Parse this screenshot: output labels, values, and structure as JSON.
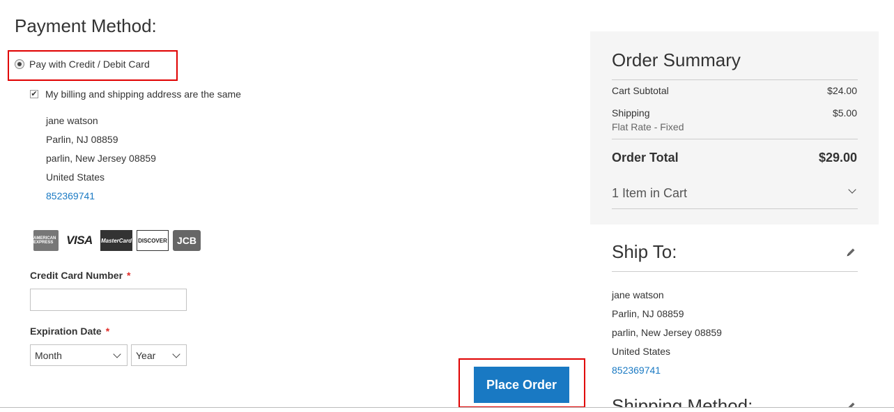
{
  "payment": {
    "title": "Payment Method:",
    "option_label": "Pay with Credit / Debit Card",
    "billing_same_label": "My billing and shipping address are the same",
    "billing_address": {
      "name": "jane watson",
      "line1": "Parlin, NJ 08859",
      "line2": "parlin, New Jersey 08859",
      "country": "United States",
      "phone": "852369741"
    },
    "cards": {
      "amex": "AMERICAN EXPRESS",
      "visa": "VISA",
      "mastercard": "MasterCard",
      "discover": "DISCOVER",
      "jcb": "JCB"
    },
    "cc_number_label": "Credit Card Number",
    "required_mark": "*",
    "cc_number_value": "",
    "expiration_label": "Expiration Date",
    "month_selected": "Month",
    "year_selected": "Year",
    "place_order_label": "Place Order"
  },
  "summary": {
    "title": "Order Summary",
    "subtotal_label": "Cart Subtotal",
    "subtotal_value": "$24.00",
    "shipping_label": "Shipping",
    "shipping_method": "Flat Rate - Fixed",
    "shipping_value": "$5.00",
    "total_label": "Order Total",
    "total_value": "$29.00",
    "items_label": "1 Item in Cart"
  },
  "ship_to": {
    "title": "Ship To:",
    "name": "jane watson",
    "line1": "Parlin, NJ 08859",
    "line2": "parlin, New Jersey 08859",
    "country": "United States",
    "phone": "852369741"
  },
  "shipping_method": {
    "title": "Shipping Method:"
  },
  "colors": {
    "accent": "#1979c3",
    "highlight": "#e00000",
    "required": "#e02b27"
  }
}
